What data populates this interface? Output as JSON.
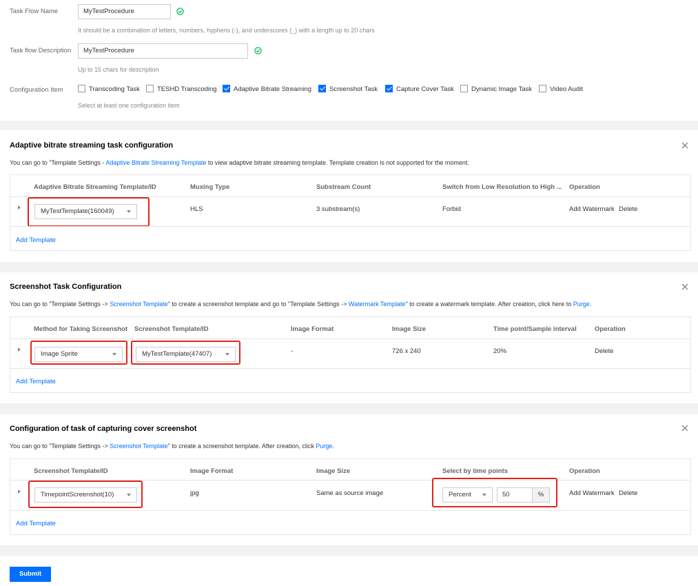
{
  "form": {
    "task_flow_name_label": "Task Flow Name",
    "task_flow_name_value": "MyTestProcedure",
    "task_flow_name_hint": "It should be a combination of letters, numbers, hyphens (-), and underscores (_) with a length up to 20 chars",
    "description_label": "Task flow Description",
    "description_value": "MyTestProcedure",
    "description_hint": "Up to 15 chars for description",
    "config_label": "Configuration Item",
    "config_hint": "Select at least one configuration item",
    "config_items": [
      {
        "label": "Transcoding Task",
        "checked": false
      },
      {
        "label": "TESHD Transcoding",
        "checked": false
      },
      {
        "label": "Adaptive Bitrate Streaming",
        "checked": true
      },
      {
        "label": "Screenshot Task",
        "checked": true
      },
      {
        "label": "Capture Cover Task",
        "checked": true
      },
      {
        "label": "Dynamic Image Task",
        "checked": false
      },
      {
        "label": "Video Audit",
        "checked": false
      }
    ]
  },
  "abs": {
    "title": "Adaptive bitrate streaming task configuration",
    "desc_1": "You can go to \"Template Settings - ",
    "desc_link": "Adaptive Bitrate Streaming Template",
    "desc_2": " to view adaptive bitrate streaming template. Template creation is not supported for the moment.",
    "headers": [
      "Adaptive Bitrate Streaming Template/ID",
      "Muxing Type",
      "Substream Count",
      "Switch from Low Resolution to High ...",
      "Operation"
    ],
    "row": {
      "template": "MyTestTemplate(160049)",
      "muxing": "HLS",
      "substreams": "3 substream(s)",
      "switch": "Forbid",
      "op_watermark": "Add Watermark",
      "op_delete": "Delete"
    },
    "add_template": "Add Template"
  },
  "shot": {
    "title": "Screenshot Task Configuration",
    "desc_1": "You can go to \"Template Settings -> ",
    "desc_link_1": "Screenshot Template",
    "desc_2": "\" to create a screenshot template and go to \"Template Settings -> ",
    "desc_link_2": "Watermark Template",
    "desc_3": "\" to create a watermark template. After creation, click here to ",
    "desc_link_3": "Purge",
    "desc_4": ".",
    "headers": [
      "Method for Taking Screenshot",
      "Screenshot Template/ID",
      "Image Format",
      "Image Size",
      "Time point/Sample interval",
      "Operation"
    ],
    "row": {
      "method": "Image Sprite",
      "template": "MyTestTemplate(47407)",
      "format": "-",
      "size": "726 x 240",
      "interval": "20%",
      "op_delete": "Delete"
    },
    "add_template": "Add Template"
  },
  "cover": {
    "title": "Configuration of task of capturing cover screenshot",
    "desc_1": "You can go to \"Template Settings -> ",
    "desc_link_1": "Screenshot Template",
    "desc_2": "\" to create a screenshot template. After creation, click ",
    "desc_link_2": "Purge",
    "desc_3": ".",
    "headers": [
      "Screenshot Template/ID",
      "Image Format",
      "Image Size",
      "Select by time points",
      "Operation"
    ],
    "row": {
      "template": "TimepointScreenshot(10)",
      "format": "jpg",
      "size": "Same as source image",
      "mode": "Percent",
      "value": "50",
      "unit": "%",
      "op_watermark": "Add Watermark",
      "op_delete": "Delete"
    },
    "add_template": "Add Template"
  },
  "submit_label": "Submit",
  "colors": {
    "accent": "#006eff",
    "success": "#0abf5b",
    "highlight": "#e2231a"
  }
}
